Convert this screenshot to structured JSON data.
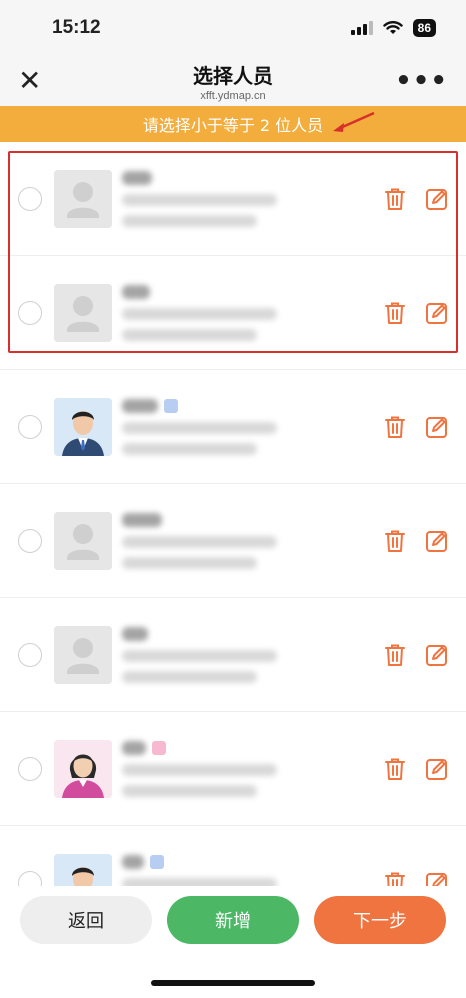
{
  "status_bar": {
    "time": "15:12",
    "battery": "86"
  },
  "nav": {
    "title": "选择人员",
    "url": "xfft.ydmap.cn",
    "close_icon": "close-icon",
    "more_icon": "more-icon"
  },
  "notice": {
    "text": "请选择小于等于 2 位人员"
  },
  "people": [
    {
      "avatar": "placeholder",
      "tag": "",
      "selected": false
    },
    {
      "avatar": "placeholder",
      "tag": "",
      "selected": false
    },
    {
      "avatar": "male",
      "tag": "blue",
      "selected": false
    },
    {
      "avatar": "placeholder",
      "tag": "",
      "selected": false
    },
    {
      "avatar": "placeholder",
      "tag": "",
      "selected": false
    },
    {
      "avatar": "female",
      "tag": "pink",
      "selected": false
    },
    {
      "avatar": "male",
      "tag": "blue",
      "selected": false
    }
  ],
  "colors": {
    "accent": "#ef7440",
    "notice": "#f2ad3c",
    "add": "#4cb866",
    "highlight": "#d7302c"
  },
  "buttons": {
    "back": "返回",
    "add": "新增",
    "next": "下一步"
  }
}
